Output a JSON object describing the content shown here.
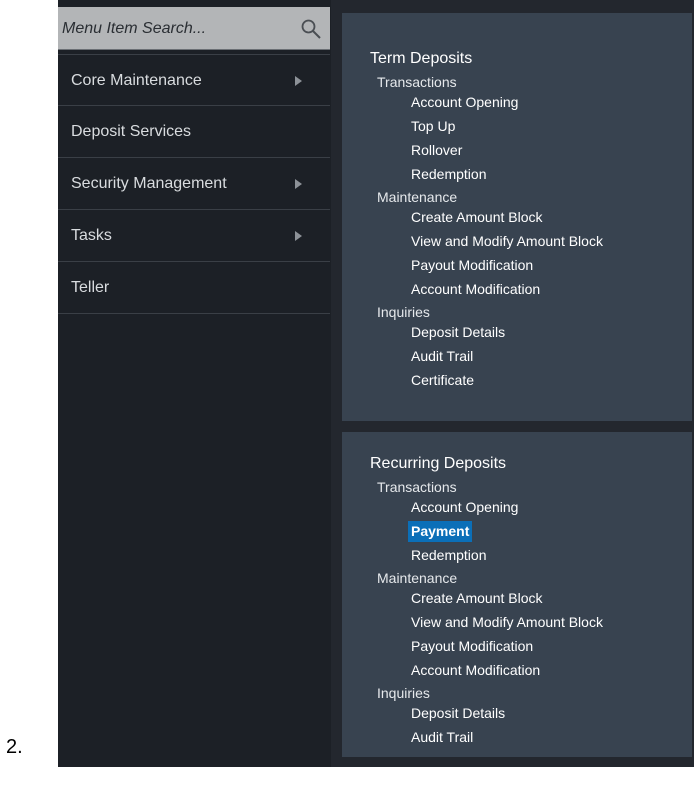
{
  "step_label": "2.",
  "search": {
    "placeholder": "Menu Item Search..."
  },
  "sidebar": {
    "items": [
      {
        "label": "Core Maintenance",
        "has_submenu": true
      },
      {
        "label": "Deposit Services",
        "has_submenu": false
      },
      {
        "label": "Security Management",
        "has_submenu": true
      },
      {
        "label": "Tasks",
        "has_submenu": true
      },
      {
        "label": "Teller",
        "has_submenu": false
      }
    ]
  },
  "term_deposits": {
    "title": "Term Deposits",
    "transactions": {
      "label": "Transactions",
      "items": [
        "Account Opening",
        "Top Up",
        "Rollover",
        "Redemption"
      ]
    },
    "maintenance": {
      "label": "Maintenance",
      "items": [
        "Create Amount Block",
        "View and Modify Amount Block",
        "Payout Modification",
        "Account Modification"
      ]
    },
    "inquiries": {
      "label": "Inquiries",
      "items": [
        "Deposit Details",
        "Audit Trail",
        "Certificate"
      ]
    }
  },
  "recurring_deposits": {
    "title": "Recurring Deposits",
    "transactions": {
      "label": "Transactions",
      "items": [
        "Account Opening",
        "Payment",
        "Redemption"
      ],
      "selected": "Payment"
    },
    "maintenance": {
      "label": "Maintenance",
      "items": [
        "Create Amount Block",
        "View and Modify Amount Block",
        "Payout Modification",
        "Account Modification"
      ]
    },
    "inquiries": {
      "label": "Inquiries",
      "items": [
        "Deposit Details",
        "Audit Trail"
      ]
    }
  },
  "colors": {
    "sidebar_bg": "#1c2026",
    "panel_bg": "#384350",
    "selected_bg": "#0b6fb8",
    "search_bg": "#b3b5b7"
  }
}
